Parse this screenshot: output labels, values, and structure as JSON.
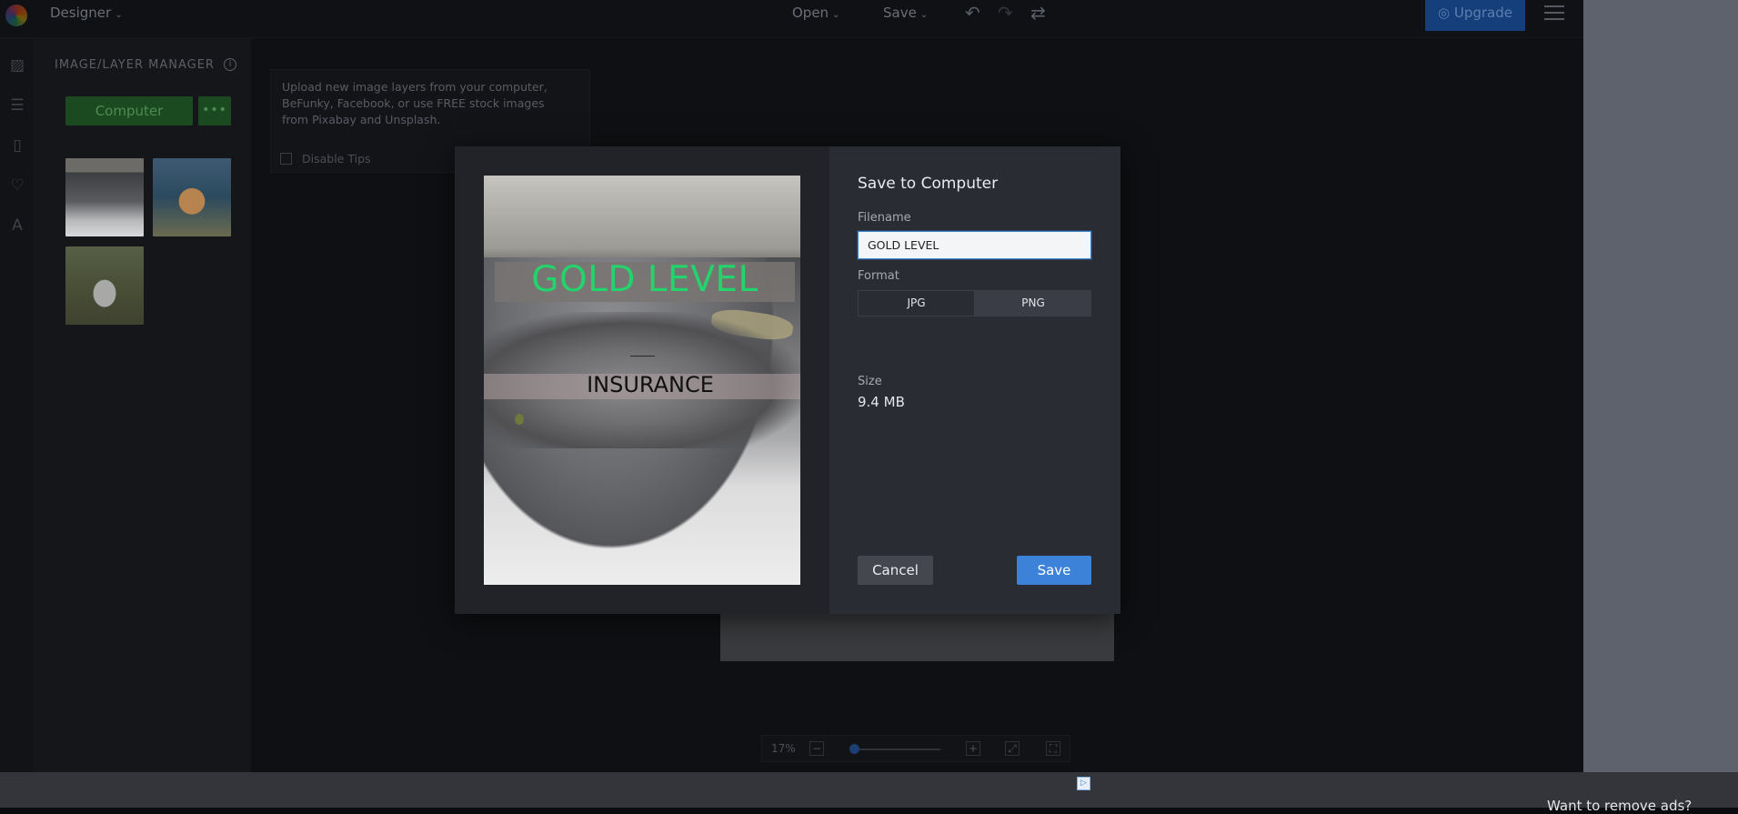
{
  "topbar": {
    "app_mode": "Designer",
    "open_label": "Open",
    "save_label": "Save",
    "upgrade_label": "Upgrade"
  },
  "panel": {
    "title": "IMAGE/LAYER MANAGER",
    "info": "i",
    "computer_button": "Computer",
    "more_button": "•••"
  },
  "tips": {
    "text": "Upload new image layers from your computer, BeFunky, Facebook, or use FREE stock images from Pixabay and Unsplash.",
    "disable_label": "Disable Tips"
  },
  "zoom": {
    "percent": "17%",
    "minus": "−",
    "plus": "+"
  },
  "ad": {
    "text": "Want to remove ads?",
    "icon_label": "▷"
  },
  "modal": {
    "title": "Save to Computer",
    "filename_label": "Filename",
    "filename_value": "GOLD LEVEL",
    "format_label": "Format",
    "formats": [
      "JPG",
      "PNG"
    ],
    "selected_format": "PNG",
    "size_label": "Size",
    "size_value": "9.4 MB",
    "cancel_label": "Cancel",
    "save_label": "Save"
  },
  "preview": {
    "headline": "GOLD LEVEL",
    "subline": "INSURANCE",
    "headline_color": "#23d36b"
  },
  "colors": {
    "accent_blue": "#3b82d8",
    "green_button": "#1c4a20",
    "modal_bg": "#2a2c33"
  }
}
